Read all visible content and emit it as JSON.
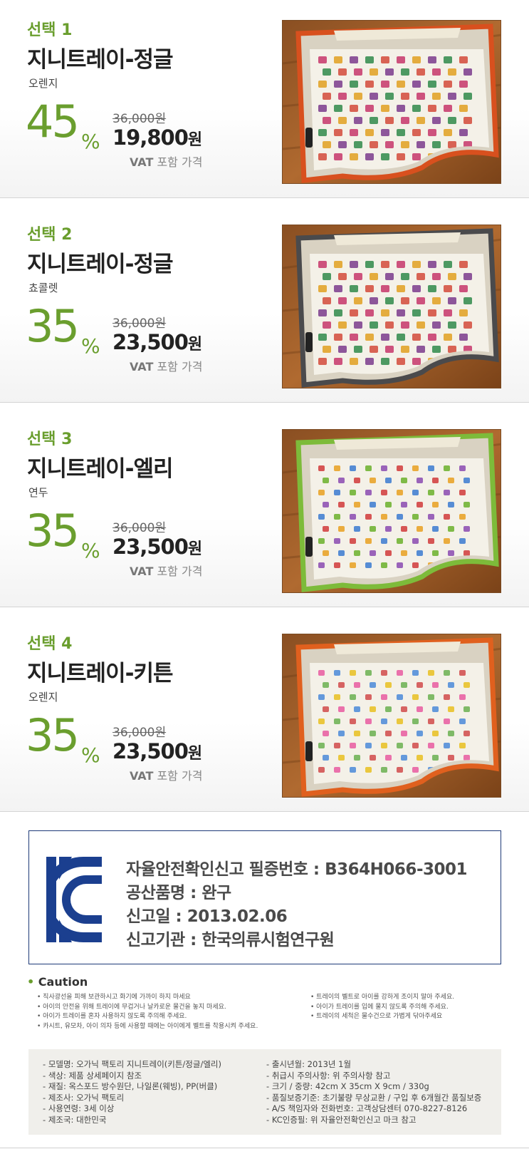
{
  "options": [
    {
      "label": "선택 1",
      "name": "지니트레이-정글",
      "color": "오렌지",
      "discount": "45",
      "percent_sign": "%",
      "original_price": "36,000원",
      "price": "19,800",
      "currency": "원",
      "vat_label": "VAT",
      "vat_text": "포함 가격",
      "rim_color": "#d8501e",
      "pattern": "jungle"
    },
    {
      "label": "선택 2",
      "name": "지니트레이-정글",
      "color": "쵸콜렛",
      "discount": "35",
      "percent_sign": "%",
      "original_price": "36,000원",
      "price": "23,500",
      "currency": "원",
      "vat_label": "VAT",
      "vat_text": "포함 가격",
      "rim_color": "#4a4a4c",
      "pattern": "jungle"
    },
    {
      "label": "선택 3",
      "name": "지니트레이-엘리",
      "color": "연두",
      "discount": "35",
      "percent_sign": "%",
      "original_price": "36,000원",
      "price": "23,500",
      "currency": "원",
      "vat_label": "VAT",
      "vat_text": "포함 가격",
      "rim_color": "#7dbb3a",
      "pattern": "elephant"
    },
    {
      "label": "선택 4",
      "name": "지니트레이-키튼",
      "color": "오렌지",
      "discount": "35",
      "percent_sign": "%",
      "original_price": "36,000원",
      "price": "23,500",
      "currency": "원",
      "vat_label": "VAT",
      "vat_text": "포함 가격",
      "rim_color": "#e0601e",
      "pattern": "kitten"
    }
  ],
  "kc": {
    "logo_color": "#1b3f8f",
    "lines": [
      "자율안전확인신고 필증번호 : B364H066-3001",
      "공산품명 : 완구",
      "신고일 : 2013.02.06",
      "신고기관 : 한국의류시험연구원"
    ]
  },
  "caution": {
    "title": "Caution",
    "left": [
      "직사광선을 피해 보관하시고 화기에 가까이 하지 마세요",
      "아이의 안전을 위해 트레이에 무겁거나 날카로운 물건을 놓지 마세요.",
      "아이가 트레이를 혼자 사용하지 않도록 주의해 주세요.",
      "카시트, 유모차, 아이 의자 등에 사용할 때에는 아이에게 벨트를 착용시켜 주세요."
    ],
    "right": [
      "트레이의 벨트로 아이를 강하게 조이지 말아 주세요.",
      "아이가 트레이를 입에 물지 않도록 주의해 주세요.",
      "트레이의 세척은 물수건으로 가볍게 닦아주세요"
    ]
  },
  "specs": {
    "left": [
      "모델명: 오가닉 팩토리 지니트레이(키튼/정글/엘리)",
      "색상: 제품 상세페이지 참조",
      "재질: 옥스포드 방수원단, 나일론(웨빙), PP(버클)",
      "제조사: 오가닉 팩토리",
      "사용연령: 3세 이상",
      "제조국: 대한민국"
    ],
    "right": [
      "출시년월: 2013년 1월",
      "취급시 주의사항: 위 주의사항 참고",
      "크기 / 중량: 42cm X 35cm X 9cm / 330g",
      "품질보증기준: 초기불량 무상교환 / 구입 후 6개월간 품질보증",
      "A/S 책임자와 전화번호: 고객상담센터 070-8227-8126",
      "KC인증필: 위 자율안전확인신고 마크 참고"
    ]
  }
}
